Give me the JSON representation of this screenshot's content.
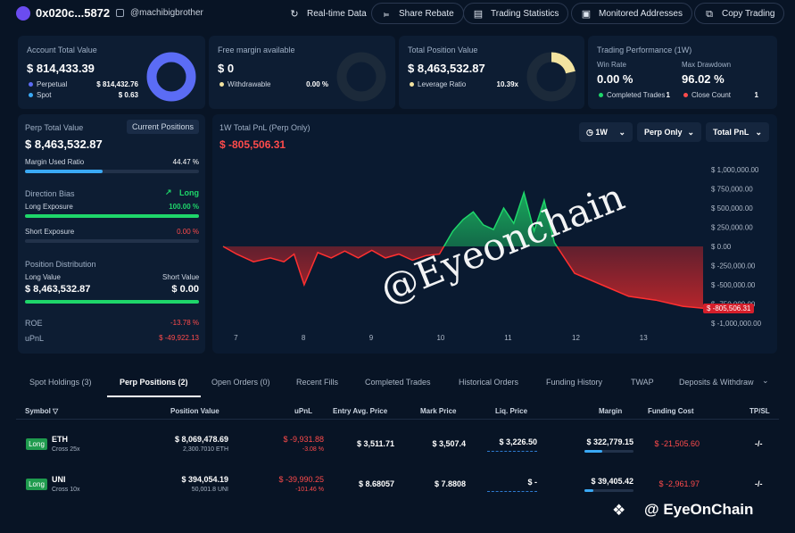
{
  "header": {
    "address": "0x020c...5872",
    "handle": "@machibigbrother",
    "buttons": [
      "Real-time Data",
      "Share Rebate",
      "Trading Statistics",
      "Monitored Addresses",
      "Copy Trading"
    ]
  },
  "account": {
    "title": "Account Total Value",
    "value": "$ 814,433.39",
    "perp_label": "Perpetual",
    "perp_value": "$ 814,432.76",
    "spot_label": "Spot",
    "spot_value": "$ 0.63"
  },
  "margin": {
    "title": "Free margin available",
    "value": "$ 0",
    "withdrawable_label": "Withdrawable",
    "withdrawable_value": "0.00 %"
  },
  "position": {
    "title": "Total Position Value",
    "value": "$ 8,463,532.87",
    "leverage_label": "Leverage Ratio",
    "leverage_value": "10.39x"
  },
  "performance": {
    "title": "Trading Performance (1W)",
    "winrate_label": "Win Rate",
    "winrate_value": "0.00 %",
    "drawdown_label": "Max Drawdown",
    "drawdown_value": "96.02 %",
    "completed_label": "Completed Trades",
    "completed_value": "1",
    "close_label": "Close Count",
    "close_value": "1"
  },
  "perp_panel": {
    "title": "Perp Total Value",
    "current_positions": "Current Positions",
    "value": "$ 8,463,532.87",
    "margin_used_label": "Margin Used Ratio",
    "margin_used_value": "44.47 %",
    "margin_used_pct": 0.4447,
    "direction_label": "Direction Bias",
    "direction_value": "Long",
    "long_label": "Long Exposure",
    "long_value": "100.00 %",
    "long_pct": 1.0,
    "short_label": "Short Exposure",
    "short_value": "0.00 %",
    "short_pct": 0.0,
    "distribution_label": "Position Distribution",
    "long_value_label": "Long Value",
    "short_value_label": "Short Value",
    "long_total": "$ 8,463,532.87",
    "short_total": "$ 0.00",
    "roe_label": "ROE",
    "roe_value": "-13.78 %",
    "upnl_label": "uPnL",
    "upnl_value": "$ -49,922.13"
  },
  "pnl_chart": {
    "title": "1W Total PnL (Perp Only)",
    "value": "$ -805,506.31",
    "dropdowns": [
      "1W",
      "Perp Only",
      "Total PnL"
    ],
    "current_label": "$ -805,506.31"
  },
  "chart_data": {
    "type": "area",
    "title": "1W Total PnL (Perp Only)",
    "y_ticks": [
      "$ 1,000,000.00",
      "$ 750,000.00",
      "$ 500,000.00",
      "$ 250,000.00",
      "$ 0.00",
      "$ -250,000.00",
      "$ -500,000.00",
      "$ -750,000.00",
      "$ -1,000,000.00"
    ],
    "ylim": [
      -1000000,
      1000000
    ],
    "x_ticks": [
      "7",
      "8",
      "9",
      "10",
      "11",
      "12",
      "13"
    ],
    "x": [
      6.8,
      7.0,
      7.25,
      7.5,
      7.7,
      7.85,
      8.0,
      8.2,
      8.4,
      8.6,
      8.8,
      9.0,
      9.2,
      9.4,
      9.6,
      9.8,
      10.0,
      10.2,
      10.35,
      10.5,
      10.65,
      10.8,
      10.95,
      11.1,
      11.25,
      11.4,
      11.55,
      11.7,
      12.0,
      12.4,
      12.8,
      13.2,
      13.6,
      13.9
    ],
    "values": [
      0,
      -100000,
      -200000,
      -150000,
      -200000,
      -100000,
      -500000,
      -80000,
      -150000,
      -60000,
      -150000,
      -50000,
      -150000,
      -100000,
      -180000,
      -120000,
      -100000,
      200000,
      350000,
      450000,
      280000,
      220000,
      500000,
      300000,
      700000,
      200000,
      600000,
      50000,
      -350000,
      -500000,
      -650000,
      -700000,
      -780000,
      -805506
    ]
  },
  "tabs": [
    "Spot Holdings (3)",
    "Perp Positions (2)",
    "Open Orders (0)",
    "Recent Fills",
    "Completed Trades",
    "Historical Orders",
    "Funding History",
    "TWAP",
    "Deposits & Withdraw"
  ],
  "table": {
    "headers": [
      "Symbol",
      "Position Value",
      "uPnL",
      "Entry Avg. Price",
      "Mark Price",
      "Liq. Price",
      "Margin",
      "Funding Cost",
      "TP/SL"
    ],
    "rows": [
      {
        "side": "Long",
        "symbol": "ETH",
        "leverage": "Cross 25x",
        "position_value": "$ 8,069,478.69",
        "position_size": "2,300.7010 ETH",
        "upnl": "$ -9,931.88",
        "upnl_pct": "-3.08 %",
        "entry": "$ 3,511.71",
        "mark": "$ 3,507.4",
        "liq": "$ 3,226.50",
        "margin": "$ 322,779.15",
        "funding": "$ -21,505.60",
        "tpsl": "-/-"
      },
      {
        "side": "Long",
        "symbol": "UNI",
        "leverage": "Cross 10x",
        "position_value": "$ 394,054.19",
        "position_size": "50,001.8 UNI",
        "upnl": "$ -39,990.25",
        "upnl_pct": "-101.46 %",
        "entry": "$ 8.68057",
        "mark": "$ 7.8808",
        "liq": "$ -",
        "margin": "$ 39,405.42",
        "funding": "$ -2,961.97",
        "tpsl": "-/-"
      }
    ]
  },
  "watermark": {
    "center": "@Eyeonchain",
    "corner": "EyeOnChain"
  },
  "colors": {
    "accent_blue": "#5b6cf5",
    "gauge_yellow": "#f2e3a0",
    "green": "#1ed66a",
    "red": "#ff4b4b"
  }
}
